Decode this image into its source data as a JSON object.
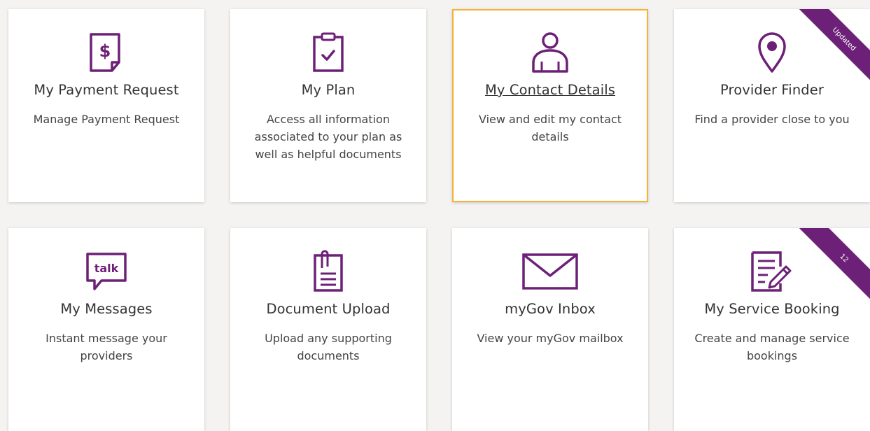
{
  "colors": {
    "accent": "#6d2077",
    "focus_border": "#f5b335",
    "background": "#f4f3f2"
  },
  "tiles": [
    {
      "title": "My Payment Request",
      "description": "Manage Payment Request",
      "icon": "payment-request-icon"
    },
    {
      "title": "My Plan",
      "description": "Access all information associated to your plan as well as helpful documents",
      "icon": "clipboard-check-icon"
    },
    {
      "title": "My Contact Details",
      "description": "View and edit my contact details",
      "icon": "person-icon"
    },
    {
      "title": "Provider Finder",
      "description": "Find a provider close to you",
      "icon": "map-pin-icon",
      "ribbon": "Updated"
    },
    {
      "title": "My Messages",
      "description": "Instant message your providers",
      "icon": "talk-bubble-icon",
      "icon_text": "talk"
    },
    {
      "title": "Document Upload",
      "description": "Upload any supporting documents",
      "icon": "document-clip-icon"
    },
    {
      "title": "myGov Inbox",
      "description": "View your myGov mailbox",
      "icon": "envelope-icon"
    },
    {
      "title": "My Service Booking",
      "description": "Create and manage service bookings",
      "icon": "booking-pencil-icon",
      "ribbon": "12"
    }
  ]
}
